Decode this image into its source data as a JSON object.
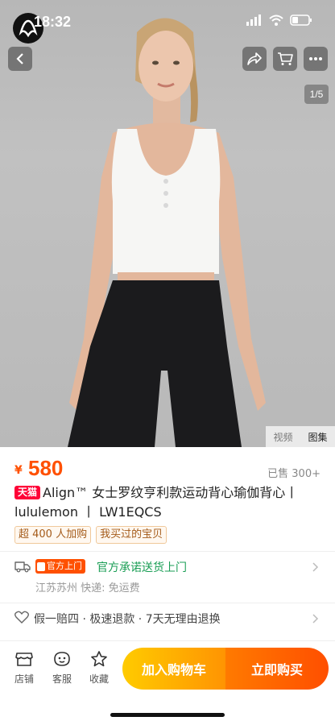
{
  "status_bar": {
    "time": "18:32"
  },
  "gallery": {
    "counter": "1/5",
    "tab_video": "视频",
    "tab_photos": "图集"
  },
  "product": {
    "price_symbol": "¥",
    "price": "580",
    "sold": "已售 300+",
    "store_badge": "天猫",
    "title": "Align™ 女士罗纹亨利款运动背心瑜伽背心丨lululemon 丨 LW1EQCS",
    "tags": [
      "超 400 人加购",
      "我买过的宝贝"
    ]
  },
  "delivery": {
    "badge": "官方上门",
    "promise": "官方承诺送货上门",
    "detail": "江苏苏州  快递: 免运费"
  },
  "guarantee": {
    "text": "假一赔四 · 极速退款 · 7天无理由退换"
  },
  "action_bar": {
    "store_label": "店铺",
    "service_label": "客服",
    "favorite_label": "收藏",
    "add_to_cart": "加入购物车",
    "buy_now": "立即购买"
  },
  "colors": {
    "price": "#ff5000",
    "tmall_red": "#ff0036",
    "promise_green": "#1a9e55",
    "cart_button": "#ffa500",
    "buy_button": "#ff5a00"
  }
}
